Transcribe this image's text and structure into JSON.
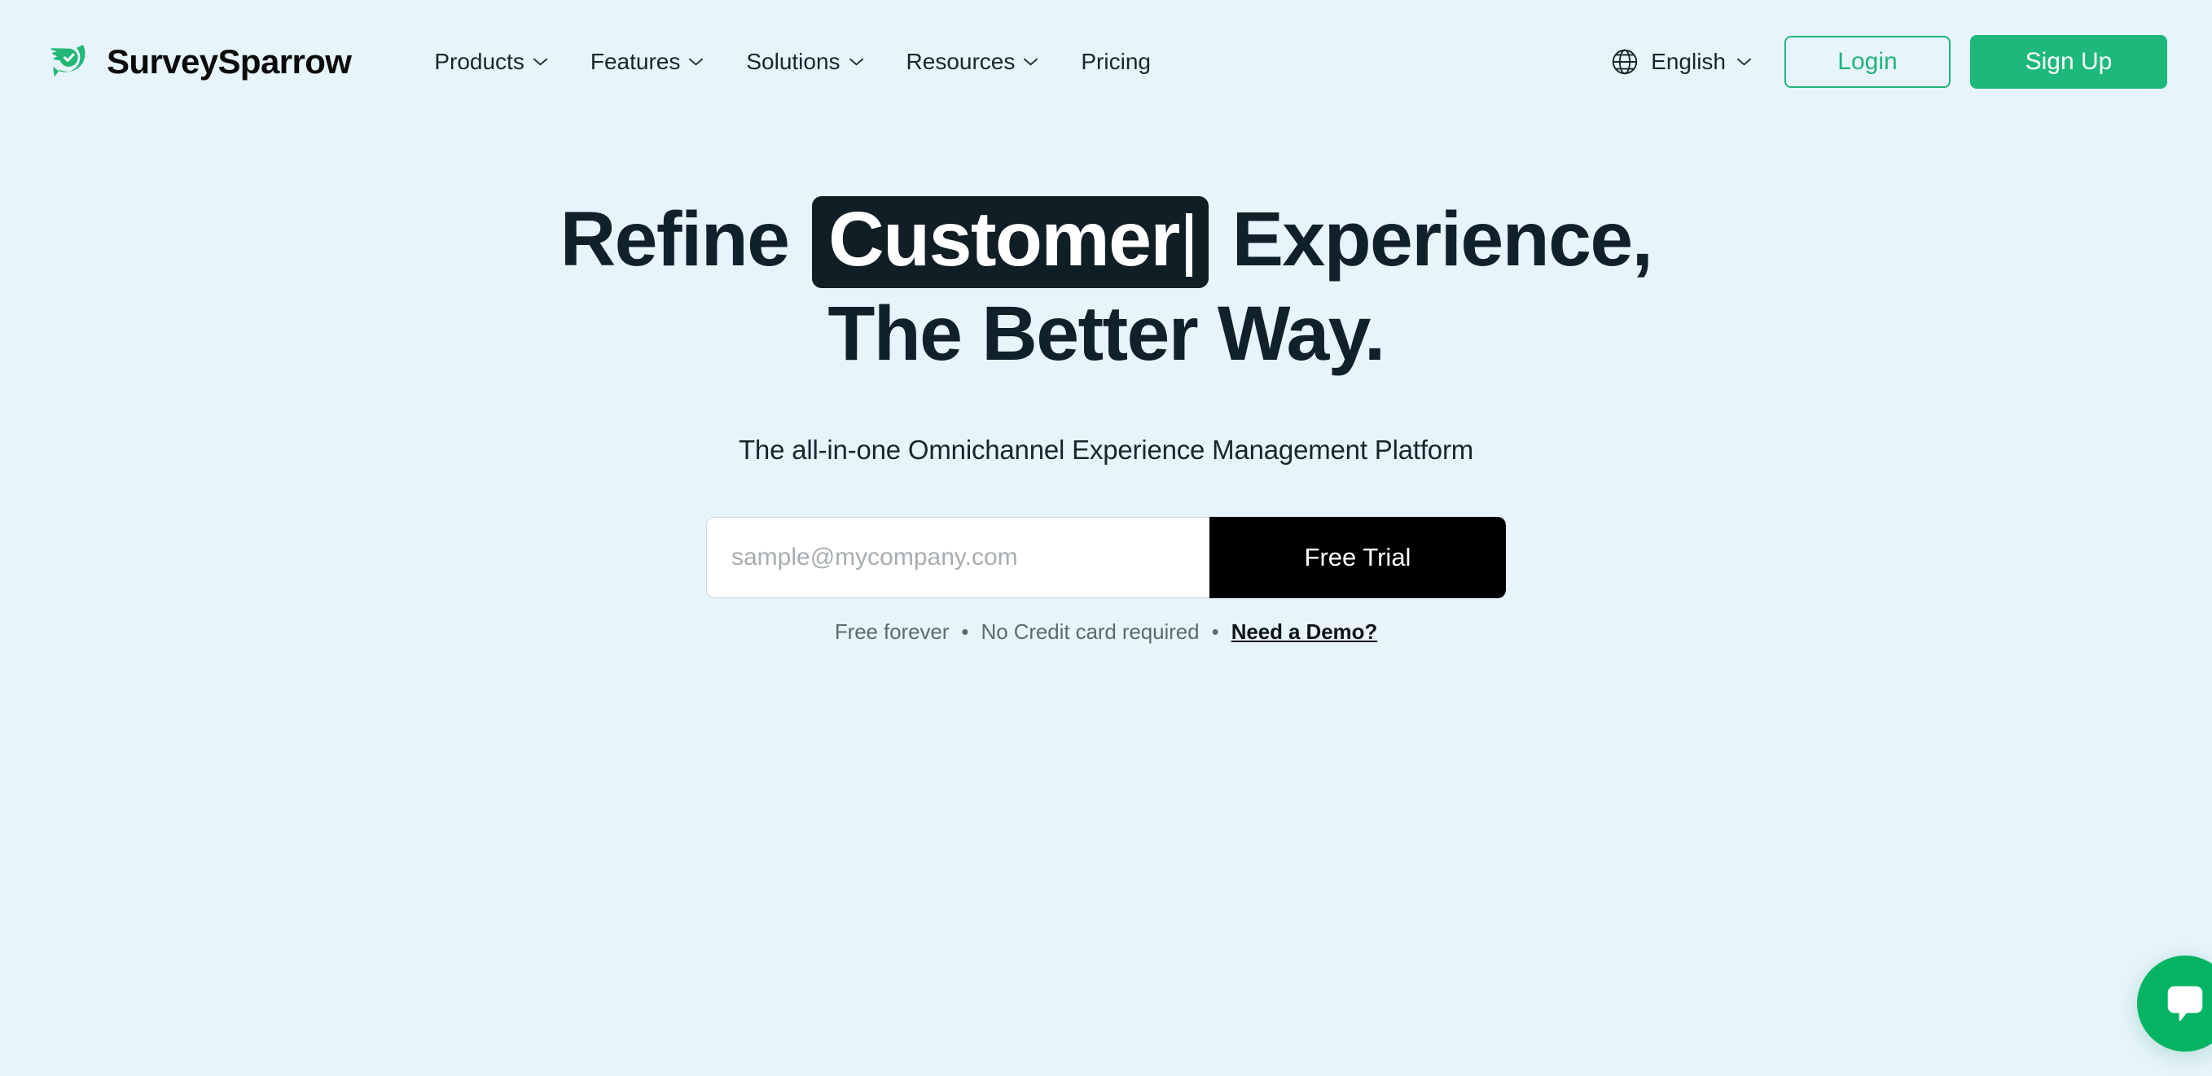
{
  "brand": {
    "name": "SurveySparrow",
    "logo_icon": "sparrow-check-logo"
  },
  "nav": {
    "items": [
      {
        "label": "Products",
        "has_dropdown": true
      },
      {
        "label": "Features",
        "has_dropdown": true
      },
      {
        "label": "Solutions",
        "has_dropdown": true
      },
      {
        "label": "Resources",
        "has_dropdown": true
      },
      {
        "label": "Pricing",
        "has_dropdown": false
      }
    ]
  },
  "header_actions": {
    "language": {
      "label": "English",
      "icon": "globe-icon",
      "has_dropdown": true
    },
    "login_label": "Login",
    "signup_label": "Sign Up"
  },
  "hero": {
    "headline_part1": "Refine",
    "headline_highlight": "Customer",
    "headline_part2": "Experience,",
    "headline_line2": "The Better Way.",
    "subheadline": "The all-in-one Omnichannel Experience Management Platform",
    "email_placeholder": "sample@mycompany.com",
    "email_value": "",
    "cta_label": "Free Trial",
    "fineprint_1": "Free forever",
    "fineprint_sep": "•",
    "fineprint_2": "No Credit card required",
    "fineprint_link": "Need a Demo?"
  },
  "chat": {
    "icon": "chat-bubble-icon"
  },
  "colors": {
    "page_background": "#e7f4fb",
    "brand_green": "#1db87a",
    "login_green": "#22b27a",
    "headline_navy": "#10212a",
    "highlight_bg": "#101e25",
    "cta_black": "#000000",
    "chat_green": "#04b463",
    "muted_text": "#5c6b72",
    "placeholder_gray": "#a7adb1"
  }
}
